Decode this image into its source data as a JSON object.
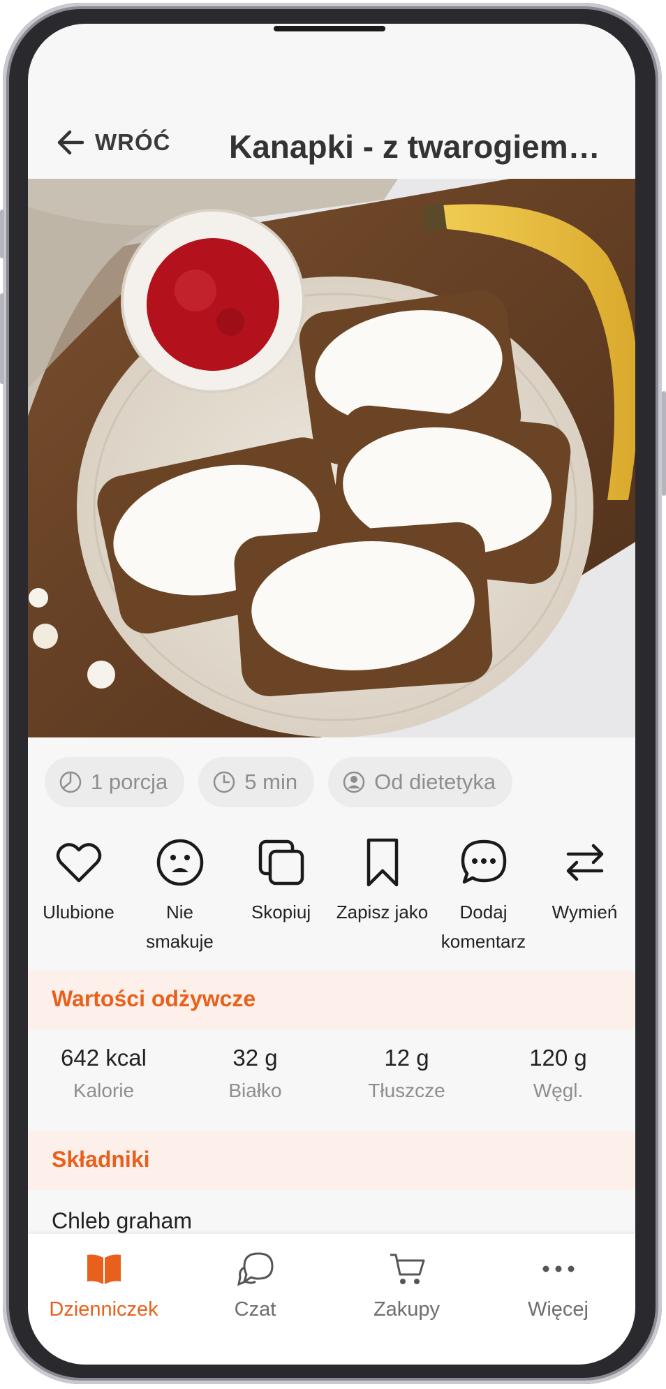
{
  "header": {
    "back_label": "WRÓĆ",
    "title": "Kanapki - z twarogiem…"
  },
  "meta_chips": [
    {
      "icon": "pie-portion-icon",
      "label": "1 porcja"
    },
    {
      "icon": "clock-icon",
      "label": "5 min"
    },
    {
      "icon": "user-circle-icon",
      "label": "Od dietetyka"
    }
  ],
  "actions": [
    {
      "icon": "heart-icon",
      "label": "Ulubione"
    },
    {
      "icon": "sad-face-icon",
      "label": "Nie smakuje"
    },
    {
      "icon": "copy-icon",
      "label": "Skopiuj"
    },
    {
      "icon": "bookmark-icon",
      "label": "Zapisz jako"
    },
    {
      "icon": "comment-icon",
      "label": "Dodaj komentarz"
    },
    {
      "icon": "swap-icon",
      "label": "Wymień"
    }
  ],
  "nutrition": {
    "title": "Wartości odżywcze",
    "items": [
      {
        "value": "642 kcal",
        "label": "Kalorie"
      },
      {
        "value": "32 g",
        "label": "Białko"
      },
      {
        "value": "12 g",
        "label": "Tłuszcze"
      },
      {
        "value": "120 g",
        "label": "Węgl."
      }
    ]
  },
  "ingredients": {
    "title": "Składniki",
    "items": [
      {
        "name": "Chleb graham"
      }
    ]
  },
  "bottom_nav": [
    {
      "icon": "book-icon",
      "label": "Dzienniczek",
      "active": true
    },
    {
      "icon": "chat-icon",
      "label": "Czat"
    },
    {
      "icon": "cart-icon",
      "label": "Zakupy"
    },
    {
      "icon": "more-dots-icon",
      "label": "Więcej"
    }
  ],
  "colors": {
    "accent": "#e8601c",
    "section_bg": "#fdf0ea",
    "chip_bg": "#ececec"
  }
}
